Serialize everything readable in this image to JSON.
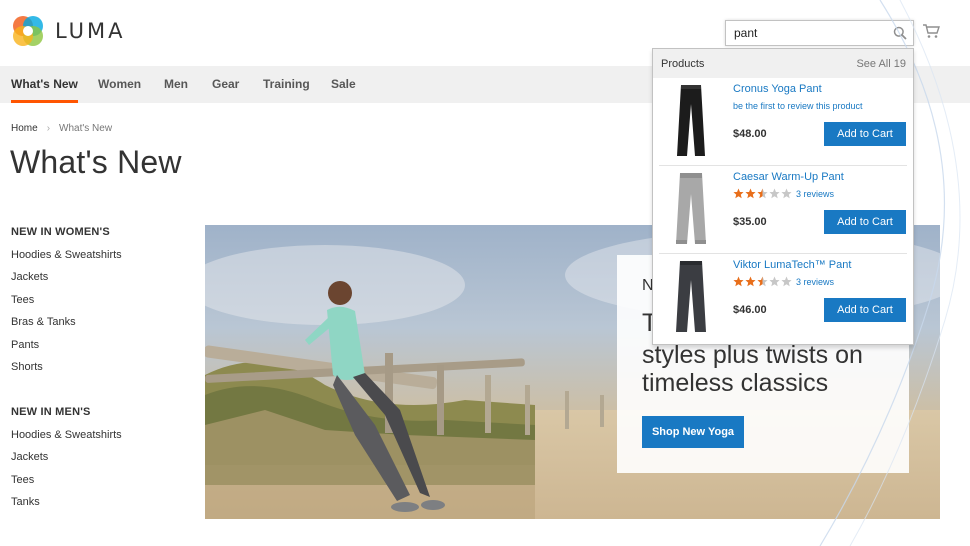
{
  "logo": {
    "text": "LUMA"
  },
  "search": {
    "value": "pant",
    "icon": "search-icon"
  },
  "cart": {
    "icon": "cart-icon"
  },
  "nav": {
    "items": [
      "What's New",
      "Women",
      "Men",
      "Gear",
      "Training",
      "Sale"
    ],
    "active": "What's New"
  },
  "breadcrumb": {
    "home": "Home",
    "separator": "›",
    "current": "What's New"
  },
  "page_title": "What's New",
  "sidebar": {
    "women_heading": "NEW IN WOMEN'S",
    "women_links": [
      "Hoodies & Sweatshirts",
      "Jackets",
      "Tees",
      "Bras & Tanks",
      "Pants",
      "Shorts"
    ],
    "men_heading": "NEW IN MEN'S",
    "men_links": [
      "Hoodies & Sweatshirts",
      "Jackets",
      "Tees",
      "Tanks"
    ]
  },
  "promo": {
    "kicker": "N",
    "line1": "T",
    "line2": "styles plus twists on",
    "line3": "timeless classics",
    "button": "Shop New Yoga"
  },
  "dropdown": {
    "header": "Products",
    "see_all": "See All 19",
    "items": [
      {
        "name": "Cronus Yoga Pant",
        "review_text": "be the first to review this product",
        "price": "$48.00",
        "button": "Add to Cart",
        "pant_color": "#1c1c1c"
      },
      {
        "name": "Caesar Warm-Up Pant",
        "stars": 2.5,
        "reviews": "3 reviews",
        "price": "$35.00",
        "button": "Add to Cart",
        "pant_color": "#a8a8a8"
      },
      {
        "name": "Viktor LumaTech™ Pant",
        "stars": 2.5,
        "reviews": "3 reviews",
        "price": "$46.00",
        "button": "Add to Cart",
        "pant_color": "#3b3d42"
      }
    ]
  },
  "colors": {
    "accent_blue": "#1979c3",
    "nav_active": "#ff5501",
    "star": "#e86e1a",
    "star_empty": "#c7c7c7"
  }
}
